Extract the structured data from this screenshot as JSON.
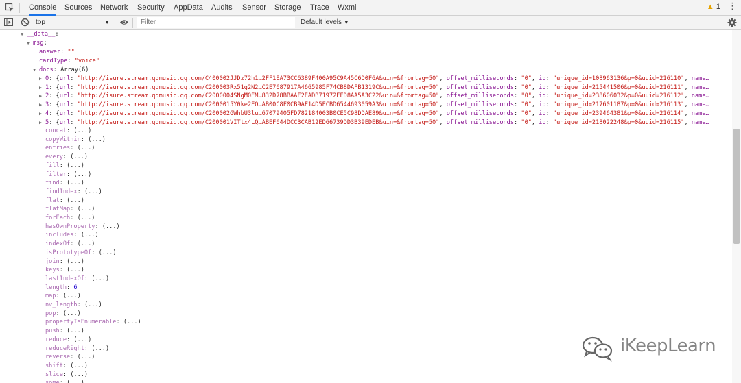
{
  "tabs": [
    "Console",
    "Sources",
    "Network",
    "Security",
    "AppData",
    "Audits",
    "Sensor",
    "Storage",
    "Trace",
    "Wxml"
  ],
  "warnings": {
    "icon": "warning-triangle-icon",
    "count": "1"
  },
  "toolbar": {
    "context": "top",
    "filter_placeholder": "Filter",
    "levels": "Default levels"
  },
  "tree": {
    "root_key": "__data__",
    "msg_key": "msg",
    "answer": {
      "key": "answer",
      "value": "\"\""
    },
    "cardType": {
      "key": "cardType",
      "value": "\"voice\""
    },
    "docs": {
      "key": "docs",
      "summary": "Array(6)"
    },
    "items": [
      {
        "index": "0",
        "url": "\"http://isure.stream.qqmusic.qq.com/C400002JJDz72h1…2FF1EA73CC6389F400A95C9A45C6D0F6A&uin=&fromtag=50\"",
        "offset": "\"0\"",
        "id": "\"unique_id=108963136&p=0&uuid=216110\""
      },
      {
        "index": "1",
        "url": "\"http://isure.stream.qqmusic.qq.com/C200003Rx51g2N2…C2E7687917A4665985F74CB8DAFB1319C&uin=&fromtag=50\"",
        "offset": "\"0\"",
        "id": "\"unique_id=215441506&p=0&uuid=216111\""
      },
      {
        "index": "2",
        "url": "\"http://isure.stream.qqmusic.qq.com/C2000004SNgM0EM…832D78BBAAF2EADB71972EED8AA5A3C22&uin=&fromtag=50\"",
        "offset": "\"0\"",
        "id": "\"unique_id=238606032&p=0&uuid=216112\""
      },
      {
        "index": "3",
        "url": "\"http://isure.stream.qqmusic.qq.com/C2000015Y0ke2EO…AB00C8F0CB9AF14D5ECBD6544693059A3&uin=&fromtag=50\"",
        "offset": "\"0\"",
        "id": "\"unique_id=217601187&p=0&uuid=216113\""
      },
      {
        "index": "4",
        "url": "\"http://isure.stream.qqmusic.qq.com/C200002GWhbU3lu…67079405FD782184003B0CE5C98DDAE89&uin=&fromtag=50\"",
        "offset": "\"0\"",
        "id": "\"unique_id=239464381&p=0&uuid=216114\""
      },
      {
        "index": "5",
        "url": "\"http://isure.stream.qqmusic.qq.com/C200001VITtx4LQ…ABEF644DCC3CAB12ED66739DD3B39EDEB&uin=&fromtag=50\"",
        "offset": "\"0\"",
        "id": "\"unique_id=218022248&p=0&uuid=216115\""
      }
    ],
    "item_url_key": "url",
    "item_offset_key": "offset_milliseconds",
    "item_id_key": "id",
    "item_tail": "name…",
    "protos": [
      {
        "key": "concat",
        "value": "(...)"
      },
      {
        "key": "copyWithin",
        "value": "(...)"
      },
      {
        "key": "entries",
        "value": "(...)"
      },
      {
        "key": "every",
        "value": "(...)"
      },
      {
        "key": "fill",
        "value": "(...)"
      },
      {
        "key": "filter",
        "value": "(...)"
      },
      {
        "key": "find",
        "value": "(...)"
      },
      {
        "key": "findIndex",
        "value": "(...)"
      },
      {
        "key": "flat",
        "value": "(...)"
      },
      {
        "key": "flatMap",
        "value": "(...)"
      },
      {
        "key": "forEach",
        "value": "(...)"
      },
      {
        "key": "hasOwnProperty",
        "value": "(...)"
      },
      {
        "key": "includes",
        "value": "(...)"
      },
      {
        "key": "indexOf",
        "value": "(...)"
      },
      {
        "key": "isPrototypeOf",
        "value": "(...)"
      },
      {
        "key": "join",
        "value": "(...)"
      },
      {
        "key": "keys",
        "value": "(...)"
      },
      {
        "key": "lastIndexOf",
        "value": "(...)"
      },
      {
        "key": "length",
        "value": "6",
        "numeric": true
      },
      {
        "key": "map",
        "value": "(...)"
      },
      {
        "key": "nv_length",
        "value": "(...)"
      },
      {
        "key": "pop",
        "value": "(...)"
      },
      {
        "key": "propertyIsEnumerable",
        "value": "(...)"
      },
      {
        "key": "push",
        "value": "(...)"
      },
      {
        "key": "reduce",
        "value": "(...)"
      },
      {
        "key": "reduceRight",
        "value": "(...)"
      },
      {
        "key": "reverse",
        "value": "(...)"
      },
      {
        "key": "shift",
        "value": "(...)"
      },
      {
        "key": "slice",
        "value": "(...)"
      },
      {
        "key": "some",
        "value": "(...)"
      }
    ]
  },
  "watermark": {
    "text": "iKeepLearn",
    "icon": "wechat-logo-icon"
  }
}
